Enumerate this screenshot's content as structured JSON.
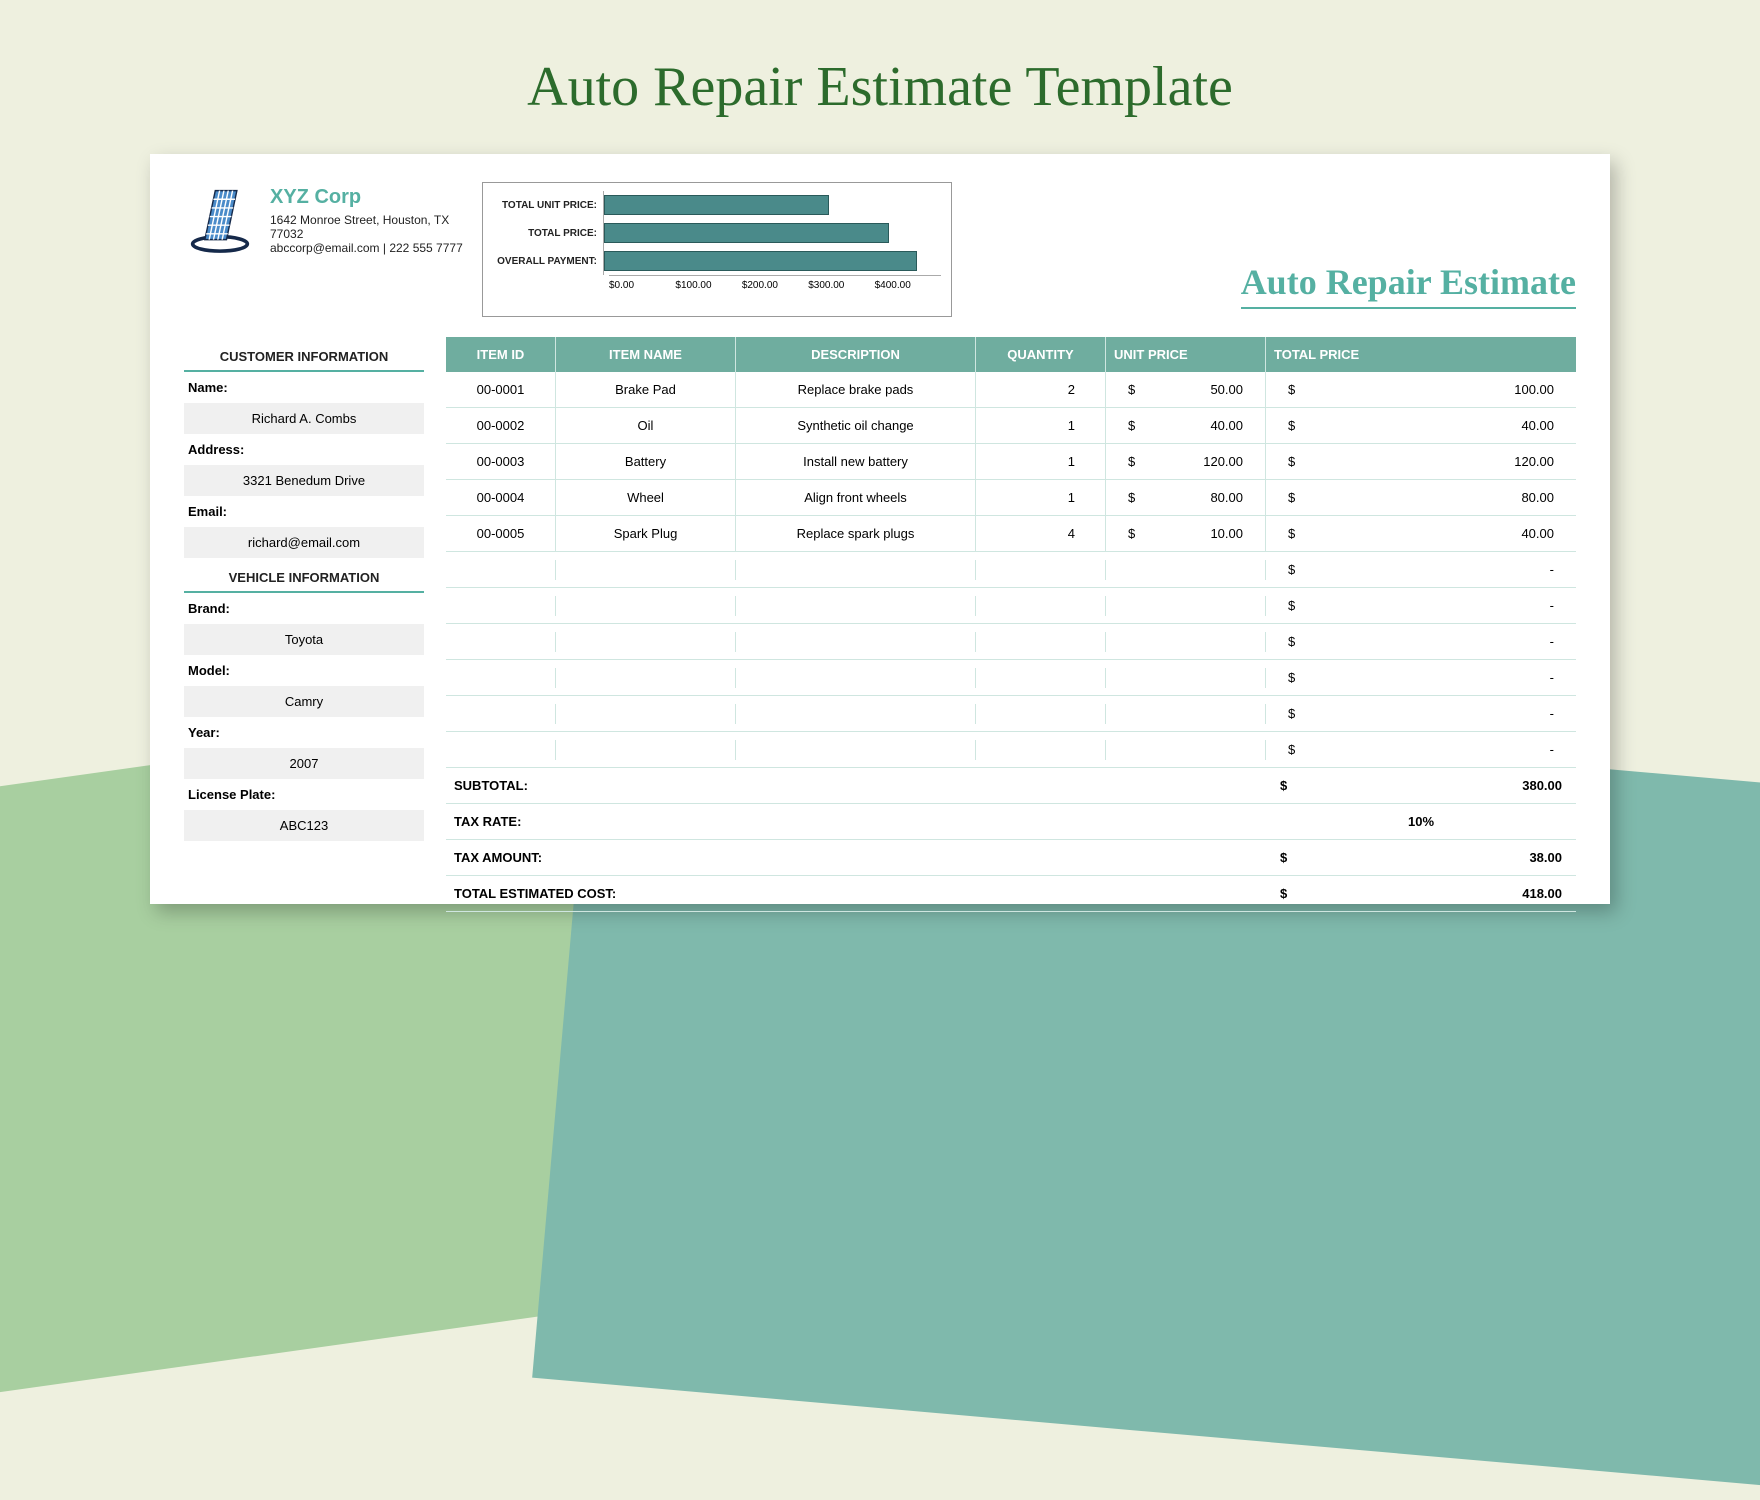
{
  "page_title": "Auto Repair Estimate Template",
  "doc_title": "Auto Repair Estimate",
  "company": {
    "name": "XYZ Corp",
    "address": "1642 Monroe Street, Houston, TX 77032",
    "contact": "abccorp@email.com | 222 555 7777"
  },
  "side": {
    "customer_heading": "CUSTOMER INFORMATION",
    "vehicle_heading": "VEHICLE INFORMATION",
    "name_label": "Name:",
    "name_value": "Richard A. Combs",
    "address_label": "Address:",
    "address_value": "3321 Benedum Drive",
    "email_label": "Email:",
    "email_value": "richard@email.com",
    "brand_label": "Brand:",
    "brand_value": "Toyota",
    "model_label": "Model:",
    "model_value": "Camry",
    "year_label": "Year:",
    "year_value": "2007",
    "plate_label": "License Plate:",
    "plate_value": "ABC123"
  },
  "headers": {
    "item_id": "ITEM ID",
    "item_name": "ITEM NAME",
    "description": "DESCRIPTION",
    "quantity": "QUANTITY",
    "unit_price": "UNIT PRICE",
    "total_price": "TOTAL PRICE"
  },
  "rows": [
    {
      "id": "00-0001",
      "name": "Brake Pad",
      "desc": "Replace brake pads",
      "qty": "2",
      "up": "50.00",
      "tp": "100.00"
    },
    {
      "id": "00-0002",
      "name": "Oil",
      "desc": "Synthetic oil change",
      "qty": "1",
      "up": "40.00",
      "tp": "40.00"
    },
    {
      "id": "00-0003",
      "name": "Battery",
      "desc": "Install new battery",
      "qty": "1",
      "up": "120.00",
      "tp": "120.00"
    },
    {
      "id": "00-0004",
      "name": "Wheel",
      "desc": "Align front wheels",
      "qty": "1",
      "up": "80.00",
      "tp": "80.00"
    },
    {
      "id": "00-0005",
      "name": "Spark Plug",
      "desc": "Replace spark plugs",
      "qty": "4",
      "up": "10.00",
      "tp": "40.00"
    }
  ],
  "empty_rows": 6,
  "currency": "$",
  "dash": "-",
  "summary": {
    "subtotal_label": "SUBTOTAL:",
    "subtotal": "380.00",
    "taxrate_label": "TAX RATE:",
    "taxrate": "10%",
    "taxamt_label": "TAX AMOUNT:",
    "taxamt": "38.00",
    "total_label": "TOTAL ESTIMATED COST:",
    "total": "418.00"
  },
  "chart_data": {
    "type": "bar",
    "orientation": "horizontal",
    "categories": [
      "TOTAL UNIT PRICE:",
      "TOTAL PRICE:",
      "OVERALL PAYMENT:"
    ],
    "values": [
      300,
      380,
      418
    ],
    "xlabel": "",
    "ylabel": "",
    "xlim": [
      0,
      450
    ],
    "ticks": [
      "$0.00",
      "$100.00",
      "$200.00",
      "$300.00",
      "$400.00"
    ]
  }
}
